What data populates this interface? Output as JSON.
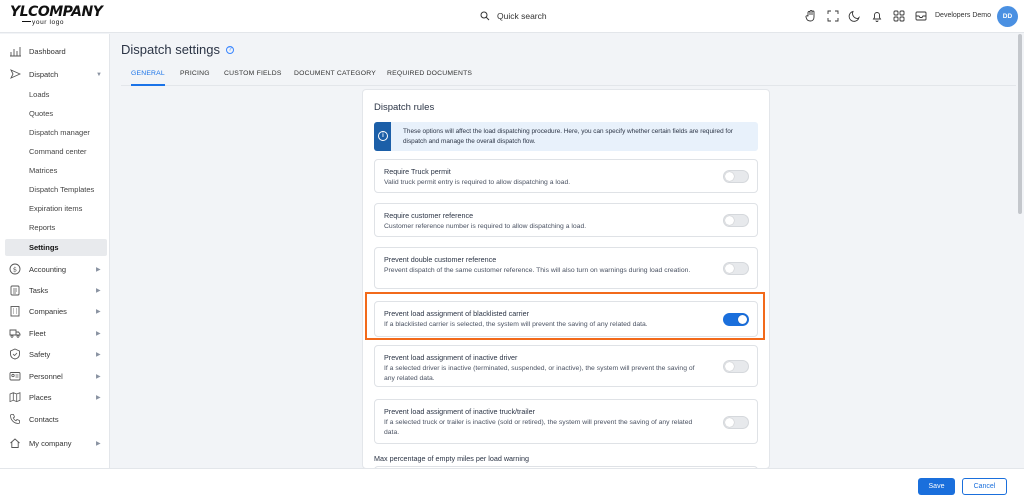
{
  "brand": {
    "logo_main": "YLCOMPANY",
    "logo_sub": "your logo"
  },
  "header": {
    "search_label": "Quick search",
    "user_name": "Developers Demo",
    "avatar_initials": "DD"
  },
  "sidebar": {
    "items": [
      {
        "label": "Dashboard",
        "icon": "bar-chart-icon"
      },
      {
        "label": "Dispatch",
        "icon": "send-icon"
      },
      {
        "label": "Loads"
      },
      {
        "label": "Quotes"
      },
      {
        "label": "Dispatch manager"
      },
      {
        "label": "Command center"
      },
      {
        "label": "Matrices"
      },
      {
        "label": "Dispatch Templates"
      },
      {
        "label": "Expiration items"
      },
      {
        "label": "Reports"
      },
      {
        "label": "Settings"
      },
      {
        "label": "Accounting",
        "icon": "dollar-icon"
      },
      {
        "label": "Tasks",
        "icon": "clipboard-icon"
      },
      {
        "label": "Companies",
        "icon": "building-icon"
      },
      {
        "label": "Fleet",
        "icon": "truck-icon"
      },
      {
        "label": "Safety",
        "icon": "shield-icon"
      },
      {
        "label": "Personnel",
        "icon": "id-card-icon"
      },
      {
        "label": "Places",
        "icon": "map-icon"
      },
      {
        "label": "Contacts",
        "icon": "phone-icon"
      },
      {
        "label": "My company",
        "icon": "home-icon"
      }
    ]
  },
  "page": {
    "title": "Dispatch settings",
    "tabs": [
      "GENERAL",
      "PRICING",
      "CUSTOM FIELDS",
      "DOCUMENT CATEGORY",
      "REQUIRED DOCUMENTS"
    ]
  },
  "panel": {
    "title": "Dispatch rules",
    "info": "These options will affect the load dispatching procedure. Here, you can specify whether certain fields are required for dispatch and manage the overall dispatch flow.",
    "rules": [
      {
        "title": "Require Truck permit",
        "desc": "Valid truck permit entry is required to allow dispatching a load.",
        "enabled": false
      },
      {
        "title": "Require customer reference",
        "desc": "Customer reference number is required to allow dispatching a load.",
        "enabled": false
      },
      {
        "title": "Prevent double customer reference",
        "desc": "Prevent dispatch of the same customer reference. This will also turn on warnings during load creation.",
        "enabled": false
      },
      {
        "title": "Prevent load assignment of blacklisted carrier",
        "desc": "If a blacklisted carrier is selected, the system will prevent the saving of any related data.",
        "enabled": true
      },
      {
        "title": "Prevent load assignment of inactive driver",
        "desc": "If a selected driver is inactive (terminated, suspended, or inactive), the system will prevent the saving of any related data.",
        "enabled": false
      },
      {
        "title": "Prevent load assignment of inactive truck/trailer",
        "desc": "If a selected truck or trailer is inactive (sold or retired), the system will prevent the saving of any related data.",
        "enabled": false
      }
    ],
    "next_heading": "Max percentage of empty miles per load warning"
  },
  "footer": {
    "save": "Save",
    "cancel": "Cancel"
  },
  "colors": {
    "accent": "#1a6fdc",
    "highlight": "#f26a1b",
    "info_strip": "#1c5fa8"
  }
}
